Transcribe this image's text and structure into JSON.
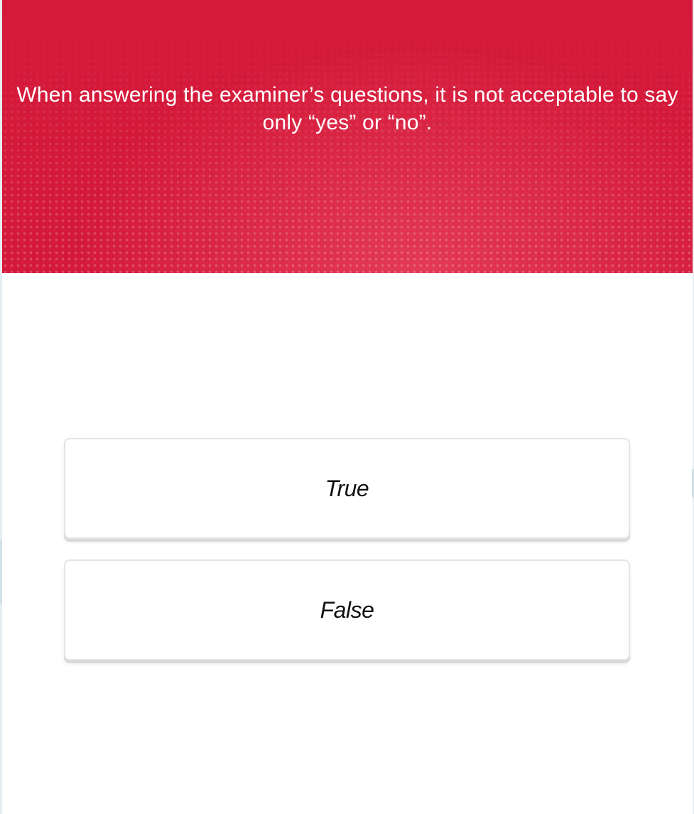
{
  "question": {
    "text": "When answering the examiner’s questions, it is not acceptable to say only “yes” or “no”."
  },
  "options": [
    {
      "label": "True"
    },
    {
      "label": "False"
    }
  ],
  "colors": {
    "header_background": "#d4193a",
    "page_background": "#ffffff",
    "option_border": "#e4e4e4",
    "question_text": "#ffffff",
    "option_text": "#111111"
  }
}
